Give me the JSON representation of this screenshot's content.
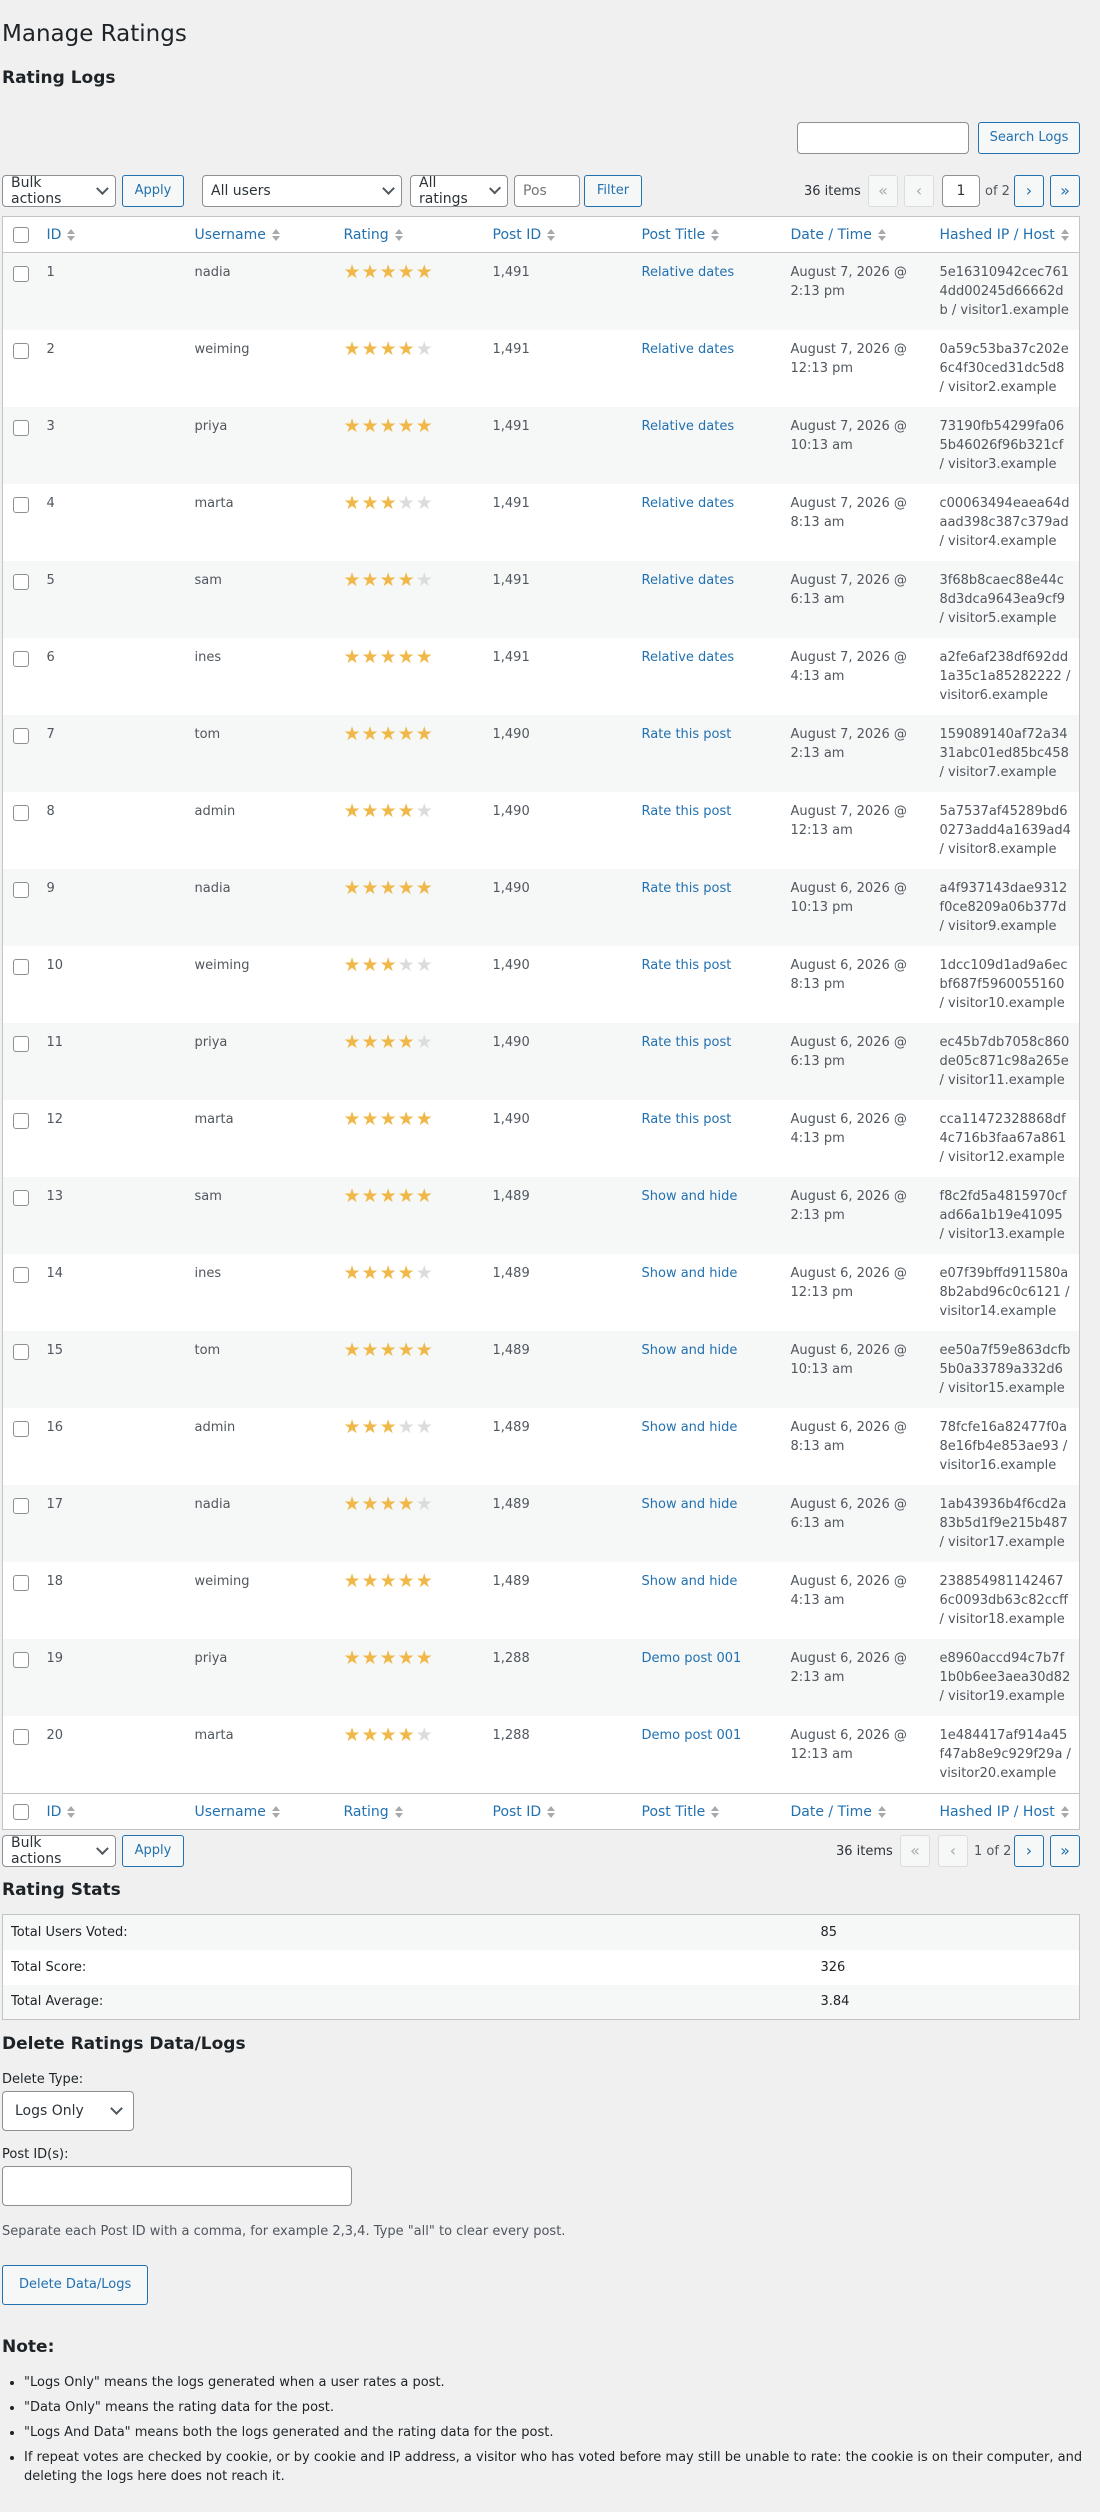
{
  "page_title": "Manage Ratings",
  "logs_heading": "Rating Logs",
  "search": {
    "value": "",
    "button": "Search Logs"
  },
  "filters": {
    "bulk_label": "Bulk actions",
    "apply": "Apply",
    "users": "All users",
    "ratings": "All ratings",
    "pos_placeholder": "Pos",
    "filter": "Filter"
  },
  "pagination": {
    "items": "36 items",
    "first": "«",
    "prev": "‹",
    "next": "›",
    "last": "»",
    "current": "1",
    "of_total": "of 2",
    "bottom_label": "1 of 2"
  },
  "columns": [
    "ID",
    "Username",
    "Rating",
    "Post ID",
    "Post Title",
    "Date / Time",
    "Hashed IP / Host"
  ],
  "rows": [
    {
      "id": "1",
      "user": "nadia",
      "rating": 5,
      "post_id": "1,491",
      "title": "Relative dates",
      "date": "August 7, 2026 @ 2:13 pm",
      "host": "5e16310942cec7614dd00245d66662db / visitor1.example"
    },
    {
      "id": "2",
      "user": "weiming",
      "rating": 4,
      "post_id": "1,491",
      "title": "Relative dates",
      "date": "August 7, 2026 @ 12:13 pm",
      "host": "0a59c53ba37c202e6c4f30ced31dc5d8 / visitor2.example"
    },
    {
      "id": "3",
      "user": "priya",
      "rating": 5,
      "post_id": "1,491",
      "title": "Relative dates",
      "date": "August 7, 2026 @ 10:13 am",
      "host": "73190fb54299fa065b46026f96b321cf / visitor3.example"
    },
    {
      "id": "4",
      "user": "marta",
      "rating": 3,
      "post_id": "1,491",
      "title": "Relative dates",
      "date": "August 7, 2026 @ 8:13 am",
      "host": "c00063494eaea64daad398c387c379ad / visitor4.example"
    },
    {
      "id": "5",
      "user": "sam",
      "rating": 4,
      "post_id": "1,491",
      "title": "Relative dates",
      "date": "August 7, 2026 @ 6:13 am",
      "host": "3f68b8caec88e44c8d3dca9643ea9cf9 / visitor5.example"
    },
    {
      "id": "6",
      "user": "ines",
      "rating": 5,
      "post_id": "1,491",
      "title": "Relative dates",
      "date": "August 7, 2026 @ 4:13 am",
      "host": "a2fe6af238df692dd1a35c1a85282222 / visitor6.example"
    },
    {
      "id": "7",
      "user": "tom",
      "rating": 5,
      "post_id": "1,490",
      "title": "Rate this post",
      "date": "August 7, 2026 @ 2:13 am",
      "host": "159089140af72a3431abc01ed85bc458 / visitor7.example"
    },
    {
      "id": "8",
      "user": "admin",
      "rating": 4,
      "post_id": "1,490",
      "title": "Rate this post",
      "date": "August 7, 2026 @ 12:13 am",
      "host": "5a7537af45289bd60273add4a1639ad4 / visitor8.example"
    },
    {
      "id": "9",
      "user": "nadia",
      "rating": 5,
      "post_id": "1,490",
      "title": "Rate this post",
      "date": "August 6, 2026 @ 10:13 pm",
      "host": "a4f937143dae9312f0ce8209a06b377d / visitor9.example"
    },
    {
      "id": "10",
      "user": "weiming",
      "rating": 3,
      "post_id": "1,490",
      "title": "Rate this post",
      "date": "August 6, 2026 @ 8:13 pm",
      "host": "1dcc109d1ad9a6ecbf687f5960055160 / visitor10.example"
    },
    {
      "id": "11",
      "user": "priya",
      "rating": 4,
      "post_id": "1,490",
      "title": "Rate this post",
      "date": "August 6, 2026 @ 6:13 pm",
      "host": "ec45b7db7058c860de05c871c98a265e / visitor11.example"
    },
    {
      "id": "12",
      "user": "marta",
      "rating": 5,
      "post_id": "1,490",
      "title": "Rate this post",
      "date": "August 6, 2026 @ 4:13 pm",
      "host": "cca11472328868df4c716b3faa67a861 / visitor12.example"
    },
    {
      "id": "13",
      "user": "sam",
      "rating": 5,
      "post_id": "1,489",
      "title": "Show and hide",
      "date": "August 6, 2026 @ 2:13 pm",
      "host": "f8c2fd5a4815970cfad66a1b19e41095 / visitor13.example"
    },
    {
      "id": "14",
      "user": "ines",
      "rating": 4,
      "post_id": "1,489",
      "title": "Show and hide",
      "date": "August 6, 2026 @ 12:13 pm",
      "host": "e07f39bffd911580a8b2abd96c0c6121 / visitor14.example"
    },
    {
      "id": "15",
      "user": "tom",
      "rating": 5,
      "post_id": "1,489",
      "title": "Show and hide",
      "date": "August 6, 2026 @ 10:13 am",
      "host": "ee50a7f59e863dcfb5b0a33789a332d6 / visitor15.example"
    },
    {
      "id": "16",
      "user": "admin",
      "rating": 3,
      "post_id": "1,489",
      "title": "Show and hide",
      "date": "August 6, 2026 @ 8:13 am",
      "host": "78fcfe16a82477f0a8e16fb4e853ae93 / visitor16.example"
    },
    {
      "id": "17",
      "user": "nadia",
      "rating": 4,
      "post_id": "1,489",
      "title": "Show and hide",
      "date": "August 6, 2026 @ 6:13 am",
      "host": "1ab43936b4f6cd2a83b5d1f9e215b487 / visitor17.example"
    },
    {
      "id": "18",
      "user": "weiming",
      "rating": 5,
      "post_id": "1,489",
      "title": "Show and hide",
      "date": "August 6, 2026 @ 4:13 am",
      "host": "2388549811424676c0093db63c82ccff / visitor18.example"
    },
    {
      "id": "19",
      "user": "priya",
      "rating": 5,
      "post_id": "1,288",
      "title": "Demo post 001",
      "date": "August 6, 2026 @ 2:13 am",
      "host": "e8960accd94c7b7f1b0b6ee3aea30d82 / visitor19.example"
    },
    {
      "id": "20",
      "user": "marta",
      "rating": 4,
      "post_id": "1,288",
      "title": "Demo post 001",
      "date": "August 6, 2026 @ 12:13 am",
      "host": "1e484417af914a45f47ab8e9c929f29a / visitor20.example"
    }
  ],
  "stats": {
    "heading": "Rating Stats",
    "rows": [
      {
        "label": "Total Users Voted:",
        "value": "85"
      },
      {
        "label": "Total Score:",
        "value": "326"
      },
      {
        "label": "Total Average:",
        "value": "3.84"
      }
    ]
  },
  "delete": {
    "heading": "Delete Ratings Data/Logs",
    "type_label": "Delete Type:",
    "type_value": "Logs Only",
    "post_label": "Post ID(s):",
    "post_value": "",
    "help": "Separate each Post ID with a comma, for example 2,3,4. Type \"all\" to clear every post.",
    "button": "Delete Data/Logs"
  },
  "note": {
    "heading": "Note:",
    "items": [
      "\"Logs Only\" means the logs generated when a user rates a post.",
      "\"Data Only\" means the rating data for the post.",
      "\"Logs And Data\" means both the logs generated and the rating data for the post.",
      "If repeat votes are checked by cookie, or by cookie and IP address, a visitor who has voted before may still be unable to rate: the cookie is on their computer, and deleting the logs here does not reach it."
    ]
  },
  "colors": {
    "accent": "#2271b1",
    "star_on": "#f0b849",
    "star_off": "#dcdcde"
  }
}
